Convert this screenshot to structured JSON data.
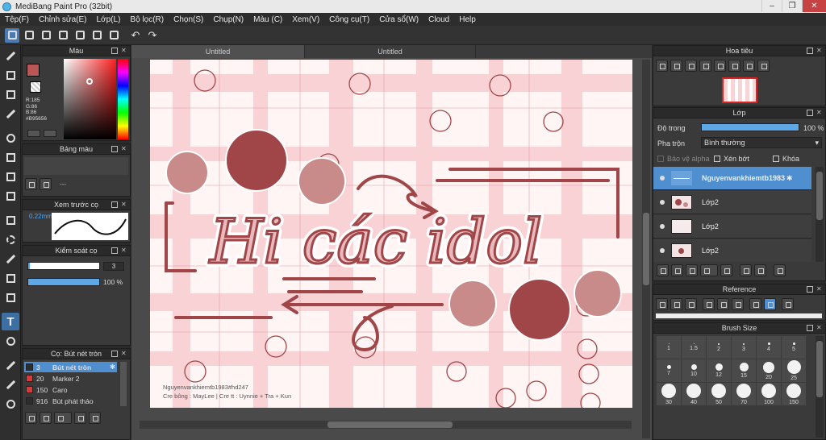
{
  "app": {
    "title": "MediBang Paint Pro (32bit)"
  },
  "menu": [
    "Tệp(F)",
    "Chỉnh sửa(E)",
    "Lớp(L)",
    "Bộ lọc(R)",
    "Chọn(S)",
    "Chụp(N)",
    "Màu (C)",
    "Xem(V)",
    "Công cụ(T)",
    "Cửa sổ(W)",
    "Cloud",
    "Help"
  ],
  "color_panel": {
    "title": "Màu",
    "r": "R:185",
    "g": "G:86",
    "b": "B:86",
    "hex": "#B95656",
    "current": "#b95656"
  },
  "palette_panel": {
    "title": "Bảng màu",
    "placeholder": "---"
  },
  "preview_panel": {
    "title": "Xem trước cọ",
    "size": "0.22mm"
  },
  "control_panel": {
    "title": "Kiểm soát cọ",
    "size_value": "3",
    "opacity_value": "100 %",
    "opacity_fraction": 1.0
  },
  "brush_panel": {
    "title": "Cọ: Bút nét tròn",
    "items": [
      {
        "size": "3",
        "name": "Bút nét tròn",
        "color": "#2d2d2d"
      },
      {
        "size": "20",
        "name": "Marker 2",
        "color": "#d83a3a"
      },
      {
        "size": "150",
        "name": "Caro",
        "color": "#d83a3a"
      },
      {
        "size": "916",
        "name": "Bút phát thảo",
        "color": "#2d2d2d"
      }
    ]
  },
  "tabs": [
    "Untitled",
    "Untitled"
  ],
  "artwork": {
    "text": "Hi các idol",
    "credit1": "Nguyenvankhiemtb1983#hd247",
    "credit2": "Cre bông : MayLee | Cre tt : Uynnie + Tra + Kun",
    "accent": "#a04648",
    "light": "#c98a8a",
    "stripe": "#f3b7bc"
  },
  "navigator": {
    "title": "Hoa tiêu"
  },
  "layer_panel": {
    "title": "Lớp",
    "opacity_label": "Độ trong",
    "opacity_value": "100 %",
    "opacity_fraction": 1.0,
    "blend_label": "Pha trộn",
    "blend_value": "Bình thường",
    "protect_alpha": "Bảo vệ alpha",
    "clip": "Xén bớt",
    "lock": "Khóa",
    "layers": [
      "Nguyenvankhiemtb1983",
      "Lớp2",
      "Lớp2",
      "Lớp2"
    ]
  },
  "reference_panel": {
    "title": "Reference"
  },
  "brushsize_panel": {
    "title": "Brush Size",
    "sizes": [
      "1",
      "1.5",
      "2",
      "3",
      "4",
      "5",
      "7",
      "10",
      "12",
      "15",
      "20",
      "25",
      "30",
      "40",
      "50",
      "70",
      "100",
      "150"
    ]
  }
}
